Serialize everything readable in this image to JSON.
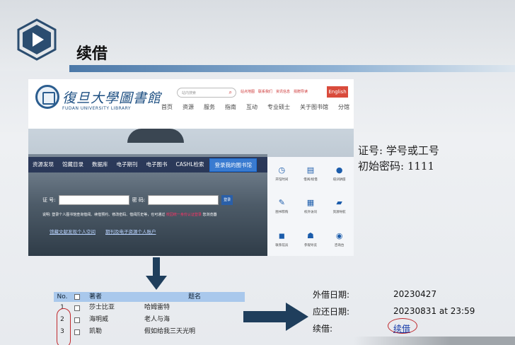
{
  "slide": {
    "title": "续借"
  },
  "library": {
    "name_cn": "復旦大學圖書館",
    "name_en": "FUDAN UNIVERSITY LIBRARY",
    "search_placeholder": "站内搜索",
    "top_links": [
      "站点地图",
      "联系我们",
      "资讯信息",
      "捐赠导读"
    ],
    "english_button": "English",
    "nav": [
      "首页",
      "资源",
      "服务",
      "指南",
      "互动",
      "专业硕士",
      "关于图书馆",
      "分馆"
    ]
  },
  "hero": {
    "tabs": [
      "资源发现",
      "馆藏目录",
      "数据库",
      "电子期刊",
      "电子图书",
      "CASHL检索",
      "登录我的图书馆"
    ],
    "login_label": "证  号:",
    "password_label": "密  码:",
    "login_button": "登录",
    "notice": "说明: 登录个人图书馆查询借阅、续借预约、修改密码、借阅历史等，也可通过",
    "notice_highlight": "校园统一身份认证登录",
    "notice_link": "您浏览器",
    "links": [
      "馆藏文献发现个人空间",
      "期刊及电子资源个人账户"
    ],
    "icons": [
      {
        "icon": "clock-icon",
        "glyph": "◷",
        "label": "开馆时间"
      },
      {
        "icon": "document-icon",
        "glyph": "▤",
        "label": "借阅/续借"
      },
      {
        "icon": "person-icon",
        "glyph": "●",
        "label": "培训讲座"
      },
      {
        "icon": "pen-icon",
        "glyph": "✎",
        "label": "图书荐购"
      },
      {
        "icon": "table-icon",
        "glyph": "▦",
        "label": "校外访问"
      },
      {
        "icon": "folder-icon",
        "glyph": "▰",
        "label": "资源导航"
      },
      {
        "icon": "book-icon",
        "glyph": "◼",
        "label": "联系馆员"
      },
      {
        "icon": "people-icon",
        "glyph": "☗",
        "label": "参观导览"
      },
      {
        "icon": "chat-icon",
        "glyph": "◉",
        "label": "咨询台"
      }
    ]
  },
  "credentials": {
    "line1": "证号: 学号或工号",
    "line2": "初始密码: 1111"
  },
  "borrow_table": {
    "headers": {
      "no": "No.",
      "author": "著者",
      "title": "题名"
    },
    "rows": [
      {
        "no": "1",
        "author": "莎士比亚",
        "title": "哈姆雷特"
      },
      {
        "no": "2",
        "author": "海明威",
        "title": "老人与海"
      },
      {
        "no": "3",
        "author": "凯勒",
        "title": "假如给我三天光明"
      }
    ]
  },
  "loan_info": {
    "borrow_date_label": "外借日期:",
    "borrow_date": "20230427",
    "due_date_label": "应还日期:",
    "due_date": "20230831 at 23:59",
    "renew_label": "续借:",
    "renew_link": "续借"
  },
  "colors": {
    "accent": "#1d4f82",
    "header_bar": "#4b78a8",
    "annotation_red": "#c0282c",
    "table_header": "#a9c8ec",
    "arrow": "#1f3e5c"
  }
}
